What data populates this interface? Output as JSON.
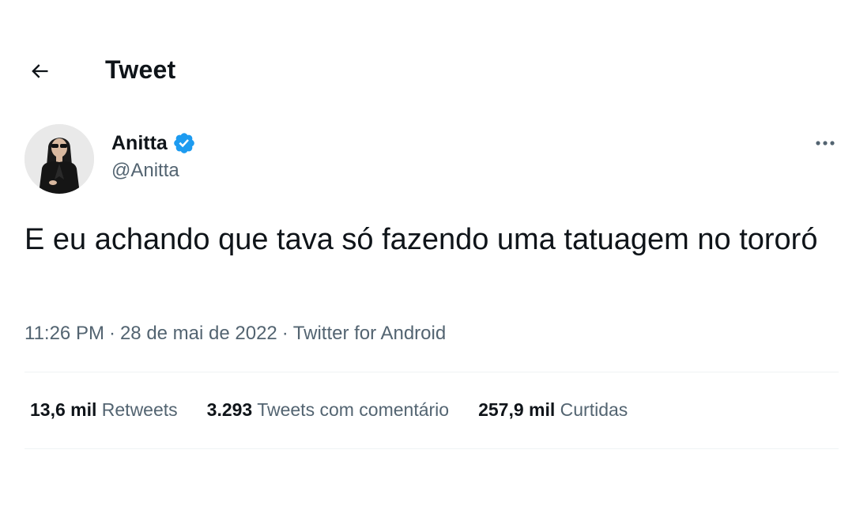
{
  "header": {
    "title": "Tweet",
    "back_icon": "arrow-left-icon"
  },
  "author": {
    "display_name": "Anitta",
    "handle": "@Anitta",
    "verified": true,
    "verified_color": "#1d9bf0"
  },
  "tweet": {
    "text": "E eu achando que tava só fazendo uma tatuagem no tororó",
    "time": "11:26 PM",
    "date": "28 de mai de 2022",
    "source": "Twitter for Android"
  },
  "stats": {
    "retweets_count": "13,6 mil",
    "retweets_label": "Retweets",
    "quotes_count": "3.293",
    "quotes_label": "Tweets com comentário",
    "likes_count": "257,9 mil",
    "likes_label": "Curtidas"
  },
  "colors": {
    "text_primary": "#0f1419",
    "text_secondary": "#536471",
    "divider": "#eff3f4"
  }
}
